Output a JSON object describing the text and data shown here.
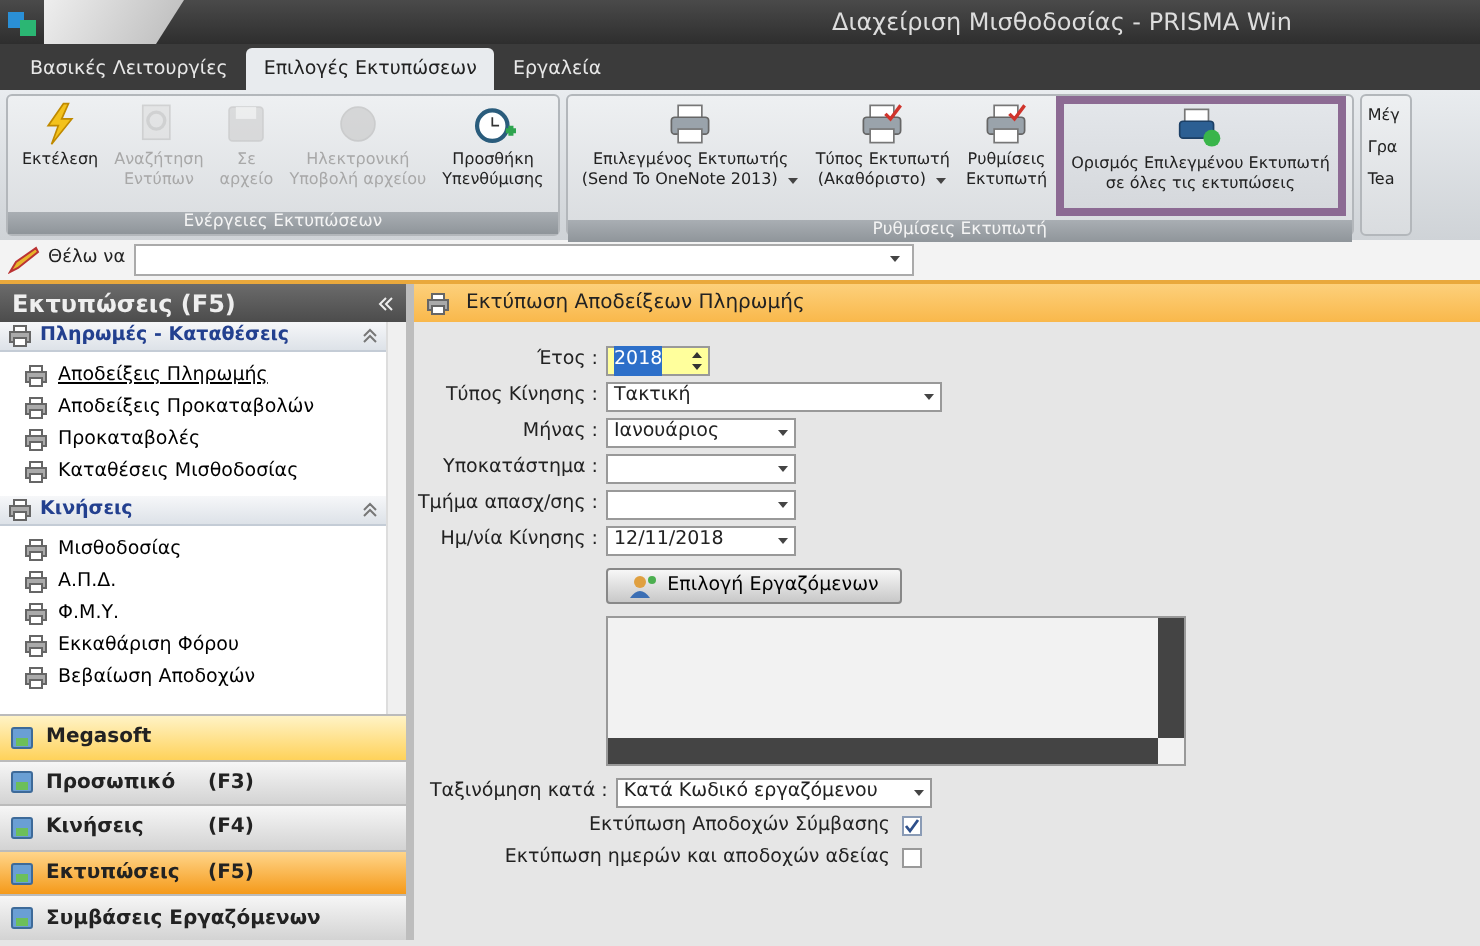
{
  "window": {
    "title": "Διαχείριση Μισθοδοσίας - PRISMA Win"
  },
  "tabs": [
    {
      "label": "Βασικές Λειτουργίες",
      "selected": false
    },
    {
      "label": "Επιλογές Εκτυπώσεων",
      "selected": true
    },
    {
      "label": "Εργαλεία",
      "selected": false
    }
  ],
  "ribbon_groups": [
    {
      "title": "Ενέργειες Εκτυπώσεων",
      "buttons": [
        {
          "lines": [
            "Εκτέλεση"
          ],
          "disabled": false,
          "dropdown": false,
          "highlighted": false
        },
        {
          "lines": [
            "Αναζήτηση",
            "Εντύπων"
          ],
          "disabled": true,
          "dropdown": false,
          "highlighted": false
        },
        {
          "lines": [
            "Σε",
            "αρχείο"
          ],
          "disabled": true,
          "dropdown": false,
          "highlighted": false
        },
        {
          "lines": [
            "Ηλεκτρονική",
            "Υποβολή αρχείου"
          ],
          "disabled": true,
          "dropdown": false,
          "highlighted": false
        },
        {
          "lines": [
            "Προσθήκη",
            "Υπενθύμισης"
          ],
          "disabled": false,
          "dropdown": false,
          "highlighted": false
        }
      ]
    },
    {
      "title": "Ρυθμίσεις Εκτυπωτή",
      "buttons": [
        {
          "lines": [
            "Επιλεγμένος Εκτυπωτής",
            "(Send To OneNote 2013)"
          ],
          "disabled": false,
          "dropdown": true,
          "highlighted": false
        },
        {
          "lines": [
            "Τύπος Εκτυπωτή",
            "(Ακαθόριστο)"
          ],
          "disabled": false,
          "dropdown": true,
          "highlighted": false
        },
        {
          "lines": [
            "Ρυθμίσεις",
            "Εκτυπωτή"
          ],
          "disabled": false,
          "dropdown": false,
          "highlighted": false
        },
        {
          "lines": [
            "Ορισμός Επιλεγμένου Εκτυπωτή",
            "σε όλες τις εκτυπώσεις"
          ],
          "disabled": false,
          "dropdown": false,
          "highlighted": true
        }
      ]
    }
  ],
  "ribbon_partial_items": [
    "Μέγ",
    "Γρα",
    "Tea"
  ],
  "search": {
    "label": "Θέλω να"
  },
  "sidebar": {
    "title": "Εκτυπώσεις (F5)",
    "groups": [
      {
        "title": "Πληρωμές - Καταθέσεις",
        "expanded": true,
        "items": [
          {
            "label": "Αποδείξεις Πληρωμής",
            "selected": true
          },
          {
            "label": "Αποδείξεις Προκαταβολών",
            "selected": false
          },
          {
            "label": "Προκαταβολές",
            "selected": false
          },
          {
            "label": "Καταθέσεις Μισθοδοσίας",
            "selected": false
          }
        ]
      },
      {
        "title": "Κινήσεις",
        "expanded": true,
        "items": [
          {
            "label": "Μισθοδοσίας",
            "selected": false
          },
          {
            "label": "Α.Π.Δ.",
            "selected": false
          },
          {
            "label": "Φ.Μ.Υ.",
            "selected": false
          },
          {
            "label": "Εκκαθάριση Φόρου",
            "selected": false
          },
          {
            "label": "Βεβαίωση Αποδοχών",
            "selected": false
          }
        ]
      }
    ],
    "nav": [
      {
        "label": "Megasoft",
        "selected": false,
        "hovered": true
      },
      {
        "label": "Προσωπικό",
        "shortcut": "(F3)",
        "selected": false,
        "hovered": false
      },
      {
        "label": "Κινήσεις",
        "shortcut": "(F4)",
        "selected": false,
        "hovered": false
      },
      {
        "label": "Εκτυπώσεις",
        "shortcut": "(F5)",
        "selected": true,
        "hovered": false
      },
      {
        "label": "Συμβάσεις Εργαζόμενων",
        "selected": false,
        "hovered": false
      }
    ]
  },
  "panel": {
    "title": "Εκτύπωση Αποδείξεων Πληρωμής",
    "fields": [
      {
        "kind": "spin",
        "label": "Έτος :",
        "value": "2018",
        "focused": true
      },
      {
        "kind": "select",
        "label": "Τύπος Κίνησης :",
        "value": "Τακτική",
        "focused": false
      },
      {
        "kind": "select",
        "label": "Μήνας :",
        "value": "Ιανουάριος",
        "focused": false
      },
      {
        "kind": "select",
        "label": "Υποκατάστημα :",
        "focused": false
      },
      {
        "kind": "select",
        "label": "Τμήμα απασχ/σης :",
        "focused": false
      },
      {
        "kind": "select",
        "label": "Ημ/νία Κίνησης :",
        "value": "12/11/2018",
        "focused": false
      }
    ],
    "employees_button": "Επιλογή Εργαζόμενων",
    "sort": {
      "label": "Ταξινόμηση κατά :",
      "value": "Κατά Κωδικό εργαζόμενου"
    },
    "options": [
      {
        "label": "Εκτύπωση Αποδοχών Σύμβασης",
        "checked": true
      },
      {
        "label": "Εκτύπωση ημερών και αποδοχών αδείας",
        "checked": false
      }
    ]
  }
}
